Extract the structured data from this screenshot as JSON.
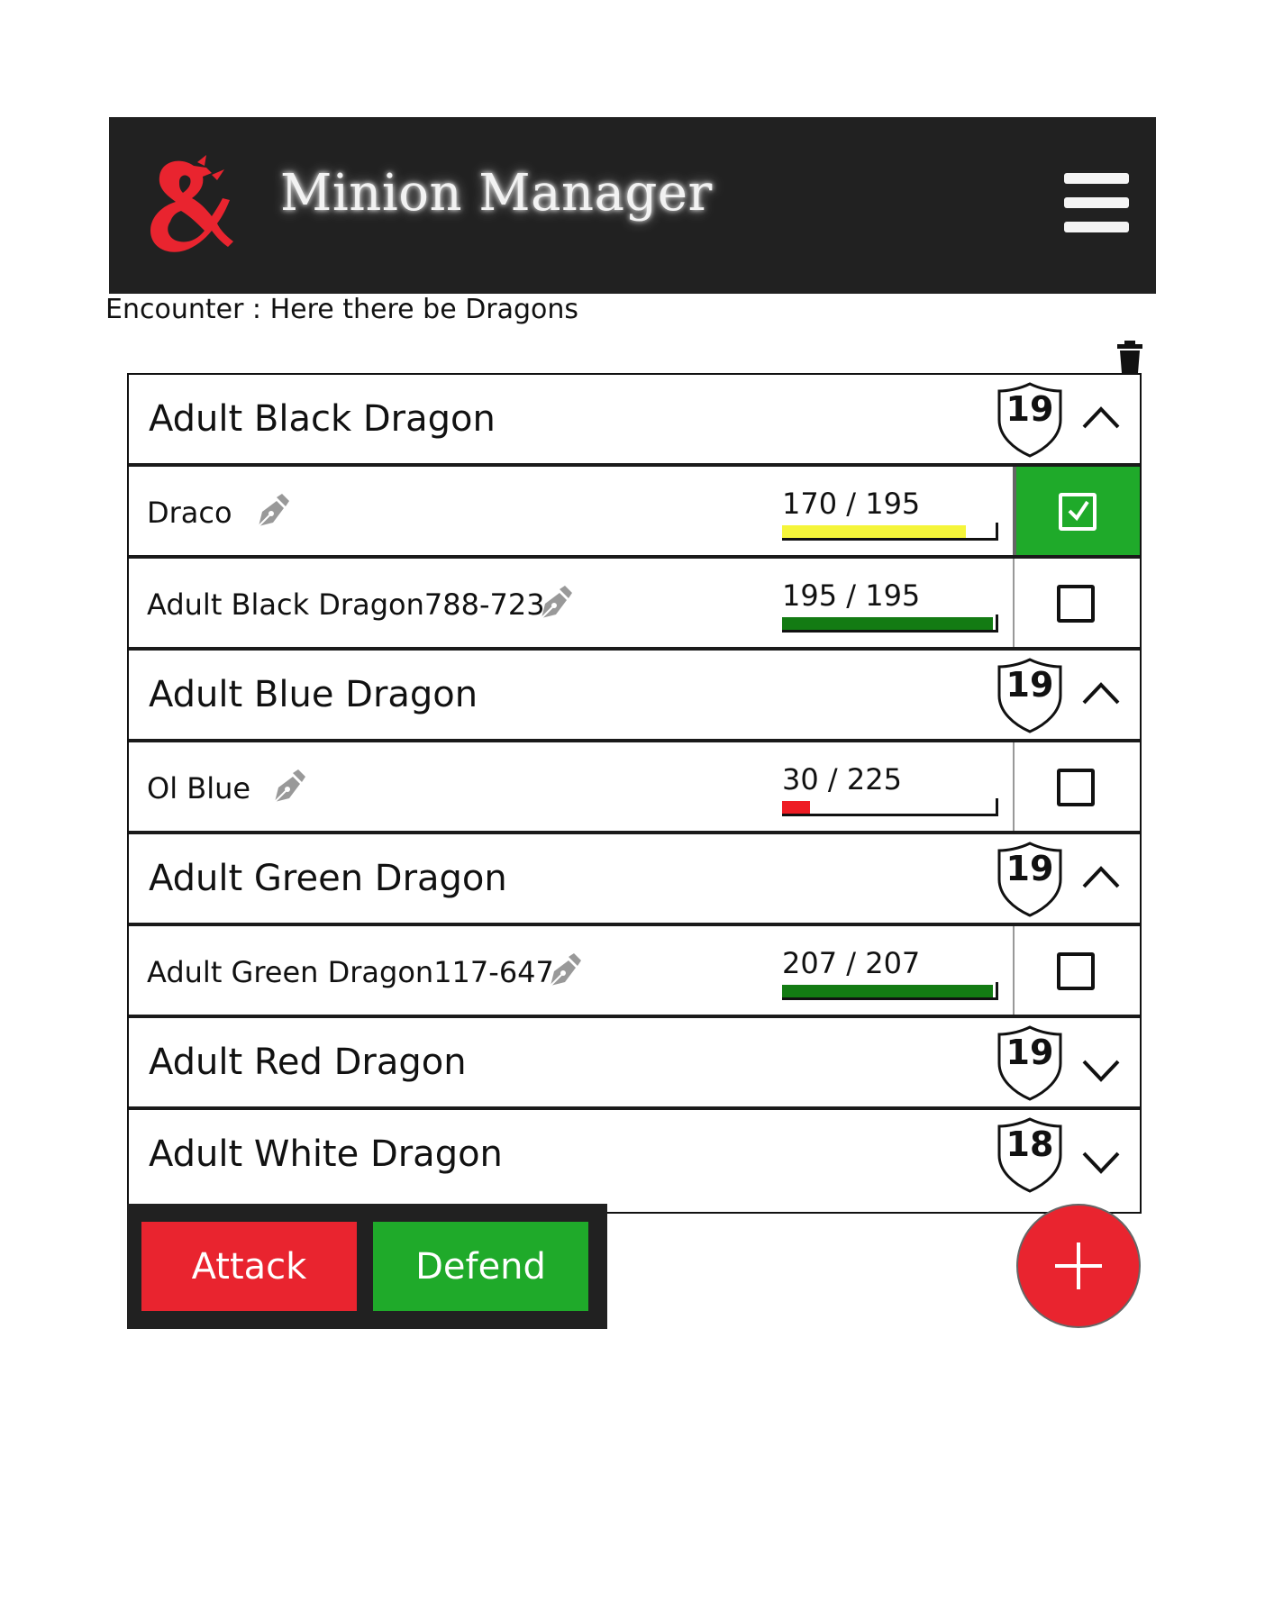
{
  "header": {
    "title": "Minion Manager",
    "logo_icon": "ampersand-dragon-logo",
    "menu_icon": "hamburger-menu-icon",
    "logo_color": "#e9242f",
    "background": "#212121"
  },
  "encounter": {
    "label": "Encounter : Here there be Dragons"
  },
  "groups": [
    {
      "name": "Adult Black Dragon",
      "ac": "19",
      "expanded": true,
      "minions": [
        {
          "name": "Draco",
          "hp": "170 / 195",
          "hp_fraction": 0.872,
          "hp_color": "#f5f53a",
          "selected": true
        },
        {
          "name": "Adult Black Dragon788-723",
          "hp": "195 / 195",
          "hp_fraction": 1.0,
          "hp_color": "#137b13",
          "selected": false
        }
      ]
    },
    {
      "name": "Adult Blue Dragon",
      "ac": "19",
      "expanded": true,
      "minions": [
        {
          "name": "Ol Blue",
          "hp": "30 / 225",
          "hp_fraction": 0.133,
          "hp_color": "#ee1c24",
          "selected": false
        }
      ]
    },
    {
      "name": "Adult Green Dragon",
      "ac": "19",
      "expanded": true,
      "minions": [
        {
          "name": "Adult Green Dragon117-647",
          "hp": "207 / 207",
          "hp_fraction": 1.0,
          "hp_color": "#137b13",
          "selected": false
        }
      ]
    },
    {
      "name": "Adult Red Dragon",
      "ac": "19",
      "expanded": false,
      "minions": []
    },
    {
      "name": "Adult White Dragon",
      "ac": "18",
      "expanded": false,
      "minions": []
    }
  ],
  "actions": {
    "attack_label": "Attack",
    "defend_label": "Defend",
    "attack_color": "#e9242f",
    "defend_color": "#1faa2a"
  },
  "fab": {
    "icon": "plus-icon",
    "color": "#e9242f"
  },
  "toolbar": {
    "delete_icon": "trash-icon"
  }
}
